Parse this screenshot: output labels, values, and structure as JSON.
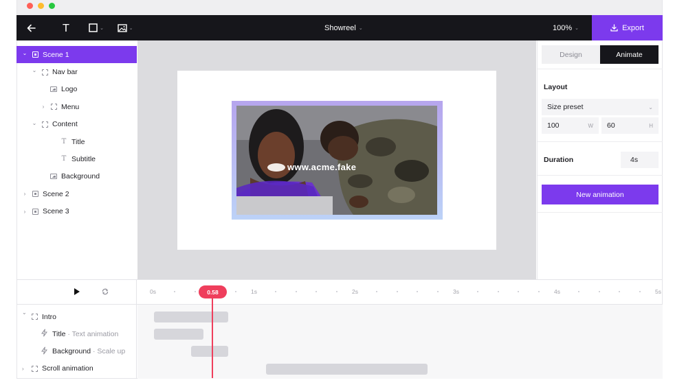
{
  "window": {
    "traffic_lights": [
      "#ff5f57",
      "#febc2e",
      "#28c840"
    ]
  },
  "toolbar": {
    "back_icon": "arrow-left-icon",
    "text_tool_icon": "text-icon",
    "shape_tool_icon": "rectangle-icon",
    "image_tool_icon": "image-icon",
    "project_name": "Showreel",
    "zoom": "100%",
    "export_label": "Export"
  },
  "layers": [
    {
      "label": "Scene 1",
      "type": "scene",
      "depth": 0,
      "expanded": true,
      "active": true
    },
    {
      "label": "Nav bar",
      "type": "frame",
      "depth": 1,
      "expanded": true
    },
    {
      "label": "Logo",
      "type": "image",
      "depth": 2
    },
    {
      "label": "Menu",
      "type": "frame",
      "depth": 2,
      "expanded": false
    },
    {
      "label": "Content",
      "type": "frame",
      "depth": 1,
      "expanded": true
    },
    {
      "label": "Title",
      "type": "text",
      "depth": 3
    },
    {
      "label": "Subtitle",
      "type": "text",
      "depth": 3
    },
    {
      "label": "Background",
      "type": "image",
      "depth": 2
    },
    {
      "label": "Scene 2",
      "type": "scene",
      "depth": 0,
      "expanded": false
    },
    {
      "label": "Scene 3",
      "type": "scene",
      "depth": 0,
      "expanded": false
    }
  ],
  "canvas": {
    "overlay_text": "www.acme.fake"
  },
  "inspector": {
    "tabs": [
      {
        "label": "Design",
        "active": false
      },
      {
        "label": "Animate",
        "active": true
      }
    ],
    "layout_heading": "Layout",
    "size_preset": "Size preset",
    "width_value": "100",
    "width_suffix": "W",
    "height_value": "60",
    "height_suffix": "H",
    "duration_label": "Duration",
    "duration_value": "4s",
    "new_animation_label": "New animation"
  },
  "timeline": {
    "play_icon": "play-icon",
    "loop_icon": "loop-icon",
    "ruler_labels": [
      "0s",
      "1s",
      "2s",
      "3s",
      "4s",
      "5s"
    ],
    "playhead_value": "0.58",
    "tracks": [
      {
        "label": "Intro",
        "sub": "",
        "type": "group"
      },
      {
        "label": "Title",
        "sub": " · Text animation",
        "type": "animation"
      },
      {
        "label": "Background",
        "sub": " · Scale up",
        "type": "animation"
      },
      {
        "label": "Scroll animation",
        "sub": "",
        "type": "group"
      }
    ],
    "accent_color": "#ef3e5c"
  },
  "colors": {
    "accent": "#7c3aed",
    "topbar": "#16161b"
  }
}
